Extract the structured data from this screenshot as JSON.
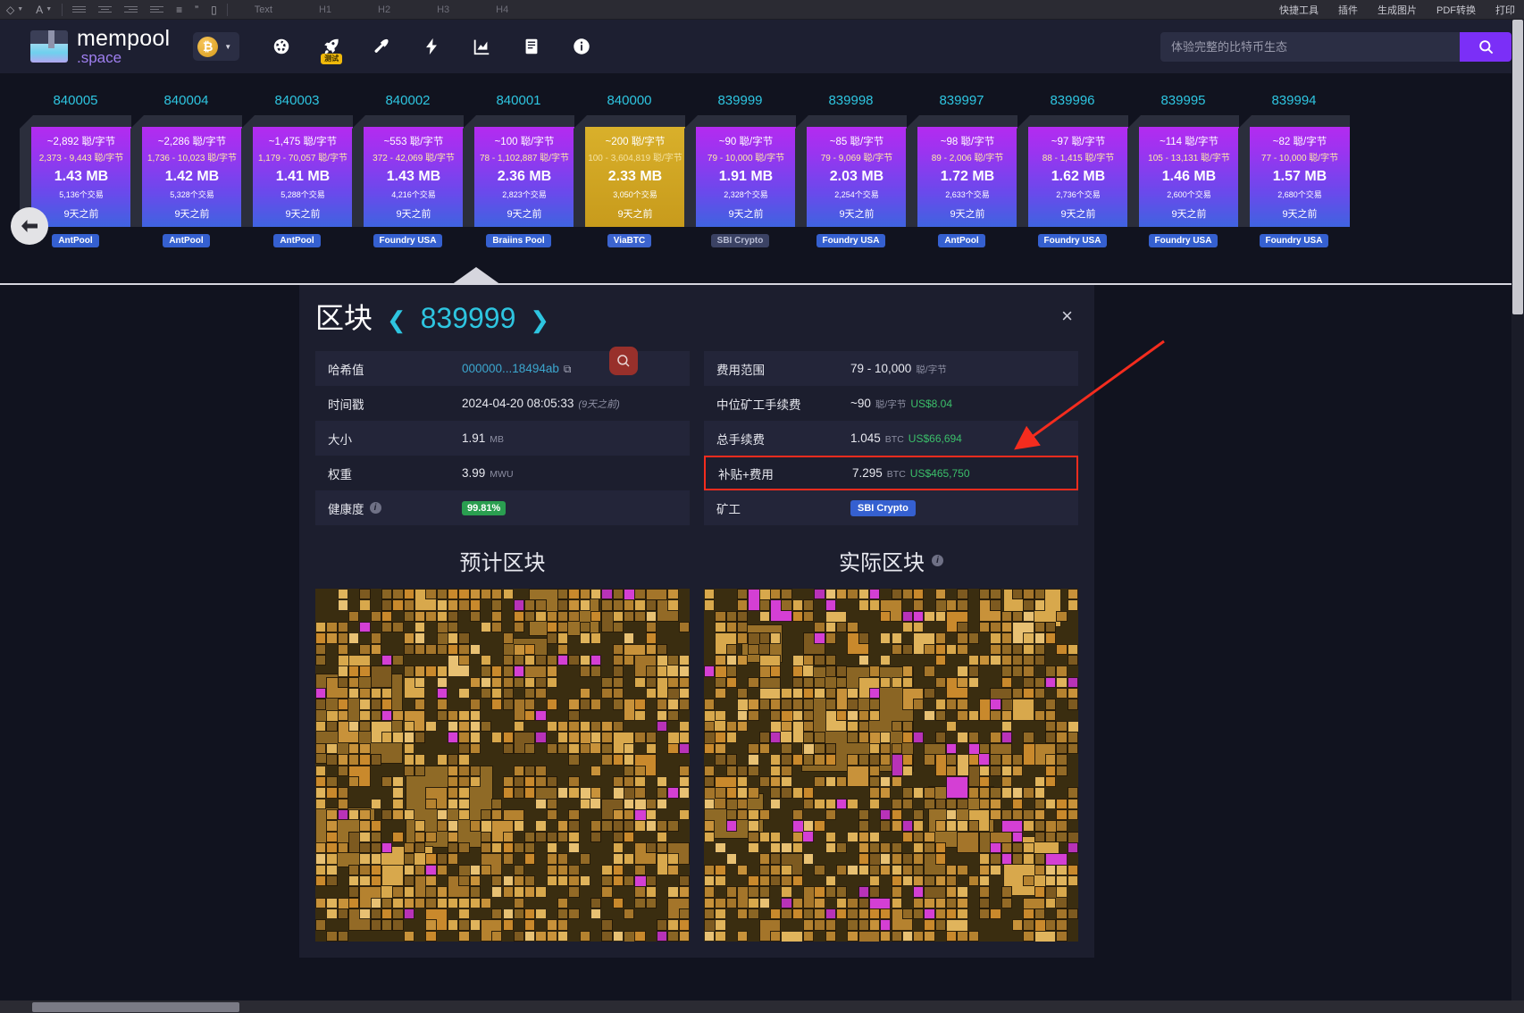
{
  "editor_strip": {
    "tools": [
      "pen-tool",
      "font-tool"
    ],
    "align_buttons": [
      "align-justify",
      "align-center",
      "align-right",
      "align-left",
      "line-height",
      "quote",
      "divider"
    ],
    "heading_styles": [
      "Text",
      "H1",
      "H2",
      "H3",
      "H4"
    ],
    "right_menu": [
      "快捷工具",
      "插件",
      "生成图片",
      "PDF转换",
      "打印"
    ]
  },
  "header": {
    "brand_line1": "mempool",
    "brand_line2": ".space",
    "coin_symbol": "₿",
    "nav_items": [
      {
        "name": "dashboard-icon",
        "badge": ""
      },
      {
        "name": "rocket-icon",
        "badge": "测试"
      },
      {
        "name": "mining-icon",
        "badge": ""
      },
      {
        "name": "lightning-icon",
        "badge": ""
      },
      {
        "name": "graphs-icon",
        "badge": ""
      },
      {
        "name": "docs-icon",
        "badge": ""
      },
      {
        "name": "about-icon",
        "badge": ""
      }
    ],
    "search_placeholder": "体验完整的比特币生态"
  },
  "chain": {
    "nav_prev_label": "←",
    "blocks": [
      {
        "height": "840005",
        "fee": "~2,892 聪/字节",
        "range": "2,373 - 9,443 聪/字节",
        "size": "1.43 MB",
        "txs": "5,136个交易",
        "age": "9天之前",
        "pool": "AntPool",
        "gold": false,
        "dim": false
      },
      {
        "height": "840004",
        "fee": "~2,286 聪/字节",
        "range": "1,736 - 10,023 聪/字节",
        "size": "1.42 MB",
        "txs": "5,328个交易",
        "age": "9天之前",
        "pool": "AntPool",
        "gold": false,
        "dim": false
      },
      {
        "height": "840003",
        "fee": "~1,475 聪/字节",
        "range": "1,179 - 70,057 聪/字节",
        "size": "1.41 MB",
        "txs": "5,288个交易",
        "age": "9天之前",
        "pool": "AntPool",
        "gold": false,
        "dim": false
      },
      {
        "height": "840002",
        "fee": "~553 聪/字节",
        "range": "372 - 42,069 聪/字节",
        "size": "1.43 MB",
        "txs": "4,216个交易",
        "age": "9天之前",
        "pool": "Foundry USA",
        "gold": false,
        "dim": false
      },
      {
        "height": "840001",
        "fee": "~100 聪/字节",
        "range": "78 - 1,102,887 聪/字节",
        "size": "2.36 MB",
        "txs": "2,823个交易",
        "age": "9天之前",
        "pool": "Braiins Pool",
        "gold": false,
        "dim": false
      },
      {
        "height": "840000",
        "fee": "~200 聪/字节",
        "range": "100 - 3,604,819 聪/字节",
        "size": "2.33 MB",
        "txs": "3,050个交易",
        "age": "9天之前",
        "pool": "ViaBTC",
        "gold": true,
        "dim": false
      },
      {
        "height": "839999",
        "fee": "~90 聪/字节",
        "range": "79 - 10,000 聪/字节",
        "size": "1.91 MB",
        "txs": "2,328个交易",
        "age": "9天之前",
        "pool": "SBI Crypto",
        "gold": false,
        "dim": true
      },
      {
        "height": "839998",
        "fee": "~85 聪/字节",
        "range": "79 - 9,069 聪/字节",
        "size": "2.03 MB",
        "txs": "2,254个交易",
        "age": "9天之前",
        "pool": "Foundry USA",
        "gold": false,
        "dim": false
      },
      {
        "height": "839997",
        "fee": "~98 聪/字节",
        "range": "89 - 2,006 聪/字节",
        "size": "1.72 MB",
        "txs": "2,633个交易",
        "age": "9天之前",
        "pool": "AntPool",
        "gold": false,
        "dim": false
      },
      {
        "height": "839996",
        "fee": "~97 聪/字节",
        "range": "88 - 1,415 聪/字节",
        "size": "1.62 MB",
        "txs": "2,736个交易",
        "age": "9天之前",
        "pool": "Foundry USA",
        "gold": false,
        "dim": false
      },
      {
        "height": "839995",
        "fee": "~114 聪/字节",
        "range": "105 - 13,131 聪/字节",
        "size": "1.46 MB",
        "txs": "2,600个交易",
        "age": "9天之前",
        "pool": "Foundry USA",
        "gold": false,
        "dim": false
      },
      {
        "height": "839994",
        "fee": "~82 聪/字节",
        "range": "77 - 10,000 聪/字节",
        "size": "1.57 MB",
        "txs": "2,680个交易",
        "age": "9天之前",
        "pool": "Foundry USA",
        "gold": false,
        "dim": false
      }
    ]
  },
  "panel": {
    "title": "区块",
    "block_height": "839999",
    "prev_chevron": "❮",
    "next_chevron": "❯",
    "close_label": "×",
    "left_rows": [
      {
        "key": "哈希值",
        "value": "000000...18494ab",
        "type": "hash"
      },
      {
        "key": "时间戳",
        "value": "2024-04-20 08:05:33",
        "suffix": "(9天之前)",
        "type": "time"
      },
      {
        "key": "大小",
        "value": "1.91",
        "unit": "MB",
        "type": "unit"
      },
      {
        "key": "权重",
        "value": "3.99",
        "unit": "MWU",
        "type": "unit"
      },
      {
        "key": "健康度",
        "value": "99.81%",
        "type": "health"
      }
    ],
    "right_rows": [
      {
        "key": "费用范围",
        "value": "79 - 10,000",
        "unit": "聪/字节",
        "type": "unit"
      },
      {
        "key": "中位矿工手续费",
        "value": "~90",
        "unit": "聪/字节",
        "usd": "US$8.04",
        "type": "fiat"
      },
      {
        "key": "总手续费",
        "value": "1.045",
        "unit": "BTC",
        "usd": "US$66,694",
        "type": "fiat"
      },
      {
        "key": "补贴+费用",
        "value": "7.295",
        "unit": "BTC",
        "usd": "US$465,750",
        "type": "fiat",
        "highlight": true
      },
      {
        "key": "矿工",
        "value": "SBI Crypto",
        "type": "pool"
      }
    ]
  },
  "viz": {
    "expected_title": "预计区块",
    "actual_title": "实际区块"
  },
  "colors": {
    "accent_cyan": "#2ec5e0",
    "brand_purple": "#9f7ff0",
    "gold_block": "#cfa422",
    "highlight_red": "#f42c1e",
    "usd_green": "#3bbf6a",
    "pool_blue": "#3560d0"
  }
}
